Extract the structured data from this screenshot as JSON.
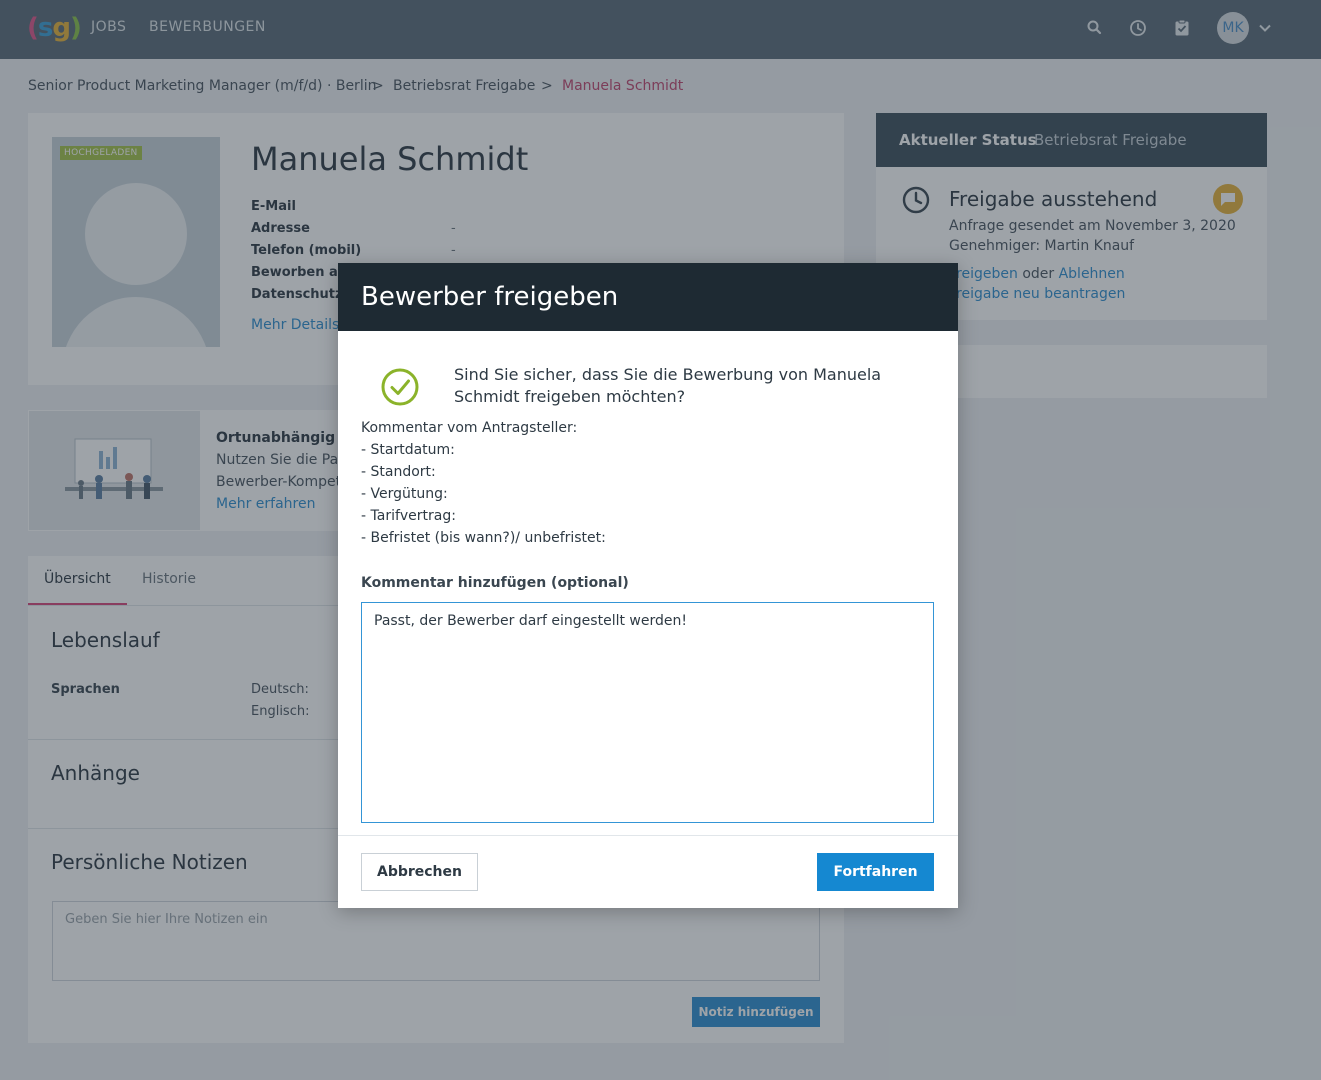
{
  "header": {
    "logo": {
      "p1": "(",
      "s": "s",
      "g": "g",
      "p2": ")"
    },
    "nav": [
      "JOBS",
      "BEWERBUNGEN"
    ],
    "icons": [
      "search-icon",
      "clock-icon",
      "clipboard-check-icon"
    ],
    "avatar_initials": "MK"
  },
  "breadcrumb": {
    "items": [
      "Senior Product Marketing Manager (m/f/d) · Berlin",
      "Betriebsrat Freigabe",
      "Manuela Schmidt"
    ],
    "separator": ">"
  },
  "profile": {
    "badge": "HOCHGELADEN",
    "name": "Manuela Schmidt",
    "fields": [
      {
        "label": "E-Mail",
        "value": ""
      },
      {
        "label": "Adresse",
        "value": "-"
      },
      {
        "label": "Telefon (mobil)",
        "value": "-"
      },
      {
        "label": "Beworben an",
        "value": ""
      },
      {
        "label": "Datenschutz",
        "value": ""
      }
    ],
    "details_link": "Mehr Details"
  },
  "promo": {
    "title": "Ortunabhängig un",
    "line1": "Nutzen Sie die Part",
    "line2": "Bewerber-Kompet",
    "link": "Mehr erfahren"
  },
  "tabs": [
    "Übersicht",
    "Historie"
  ],
  "cv": {
    "title": "Lebenslauf",
    "languages_label": "Sprachen",
    "languages": [
      "Deutsch:",
      "Englisch:"
    ]
  },
  "attachments": {
    "title": "Anhänge"
  },
  "notes": {
    "title": "Persönliche Notizen",
    "placeholder": "Geben Sie hier Ihre Notizen ein",
    "button": "Notiz hinzufügen"
  },
  "status": {
    "label": "Aktueller Status",
    "value": "Betriebsrat Freigabe",
    "heading": "Freigabe ausstehend",
    "sent": "Anfrage gesendet am November 3, 2020",
    "approver": "Genehmiger: Martin Knauf",
    "approve_link": "Freigeben",
    "or": "oder",
    "reject_link": "Ablehnen",
    "rerequest_link": "Freigabe neu beantragen"
  },
  "modal": {
    "title": "Bewerber freigeben",
    "question": "Sind Sie sicher, dass Sie die Bewerbung von Manuela Schmidt freigeben möchten?",
    "comment_lines": [
      "Kommentar vom Antragsteller:",
      "- Startdatum:",
      "- Standort:",
      "- Vergütung:",
      "- Tarifvertrag:",
      "- Befristet (bis wann?)/ unbefristet:"
    ],
    "add_comment_label": "Kommentar hinzufügen (optional)",
    "comment_value": "Passt, der Bewerber darf eingestellt werden!",
    "cancel": "Abbrechen",
    "confirm": "Fortfahren"
  },
  "colors": {
    "topbar": "#5a6b78",
    "accent_pink": "#d9467a",
    "link_blue": "#2f8ed0",
    "primary_button": "#1588d1",
    "success_green": "#8bb32a",
    "modal_header": "#1e2a33"
  }
}
